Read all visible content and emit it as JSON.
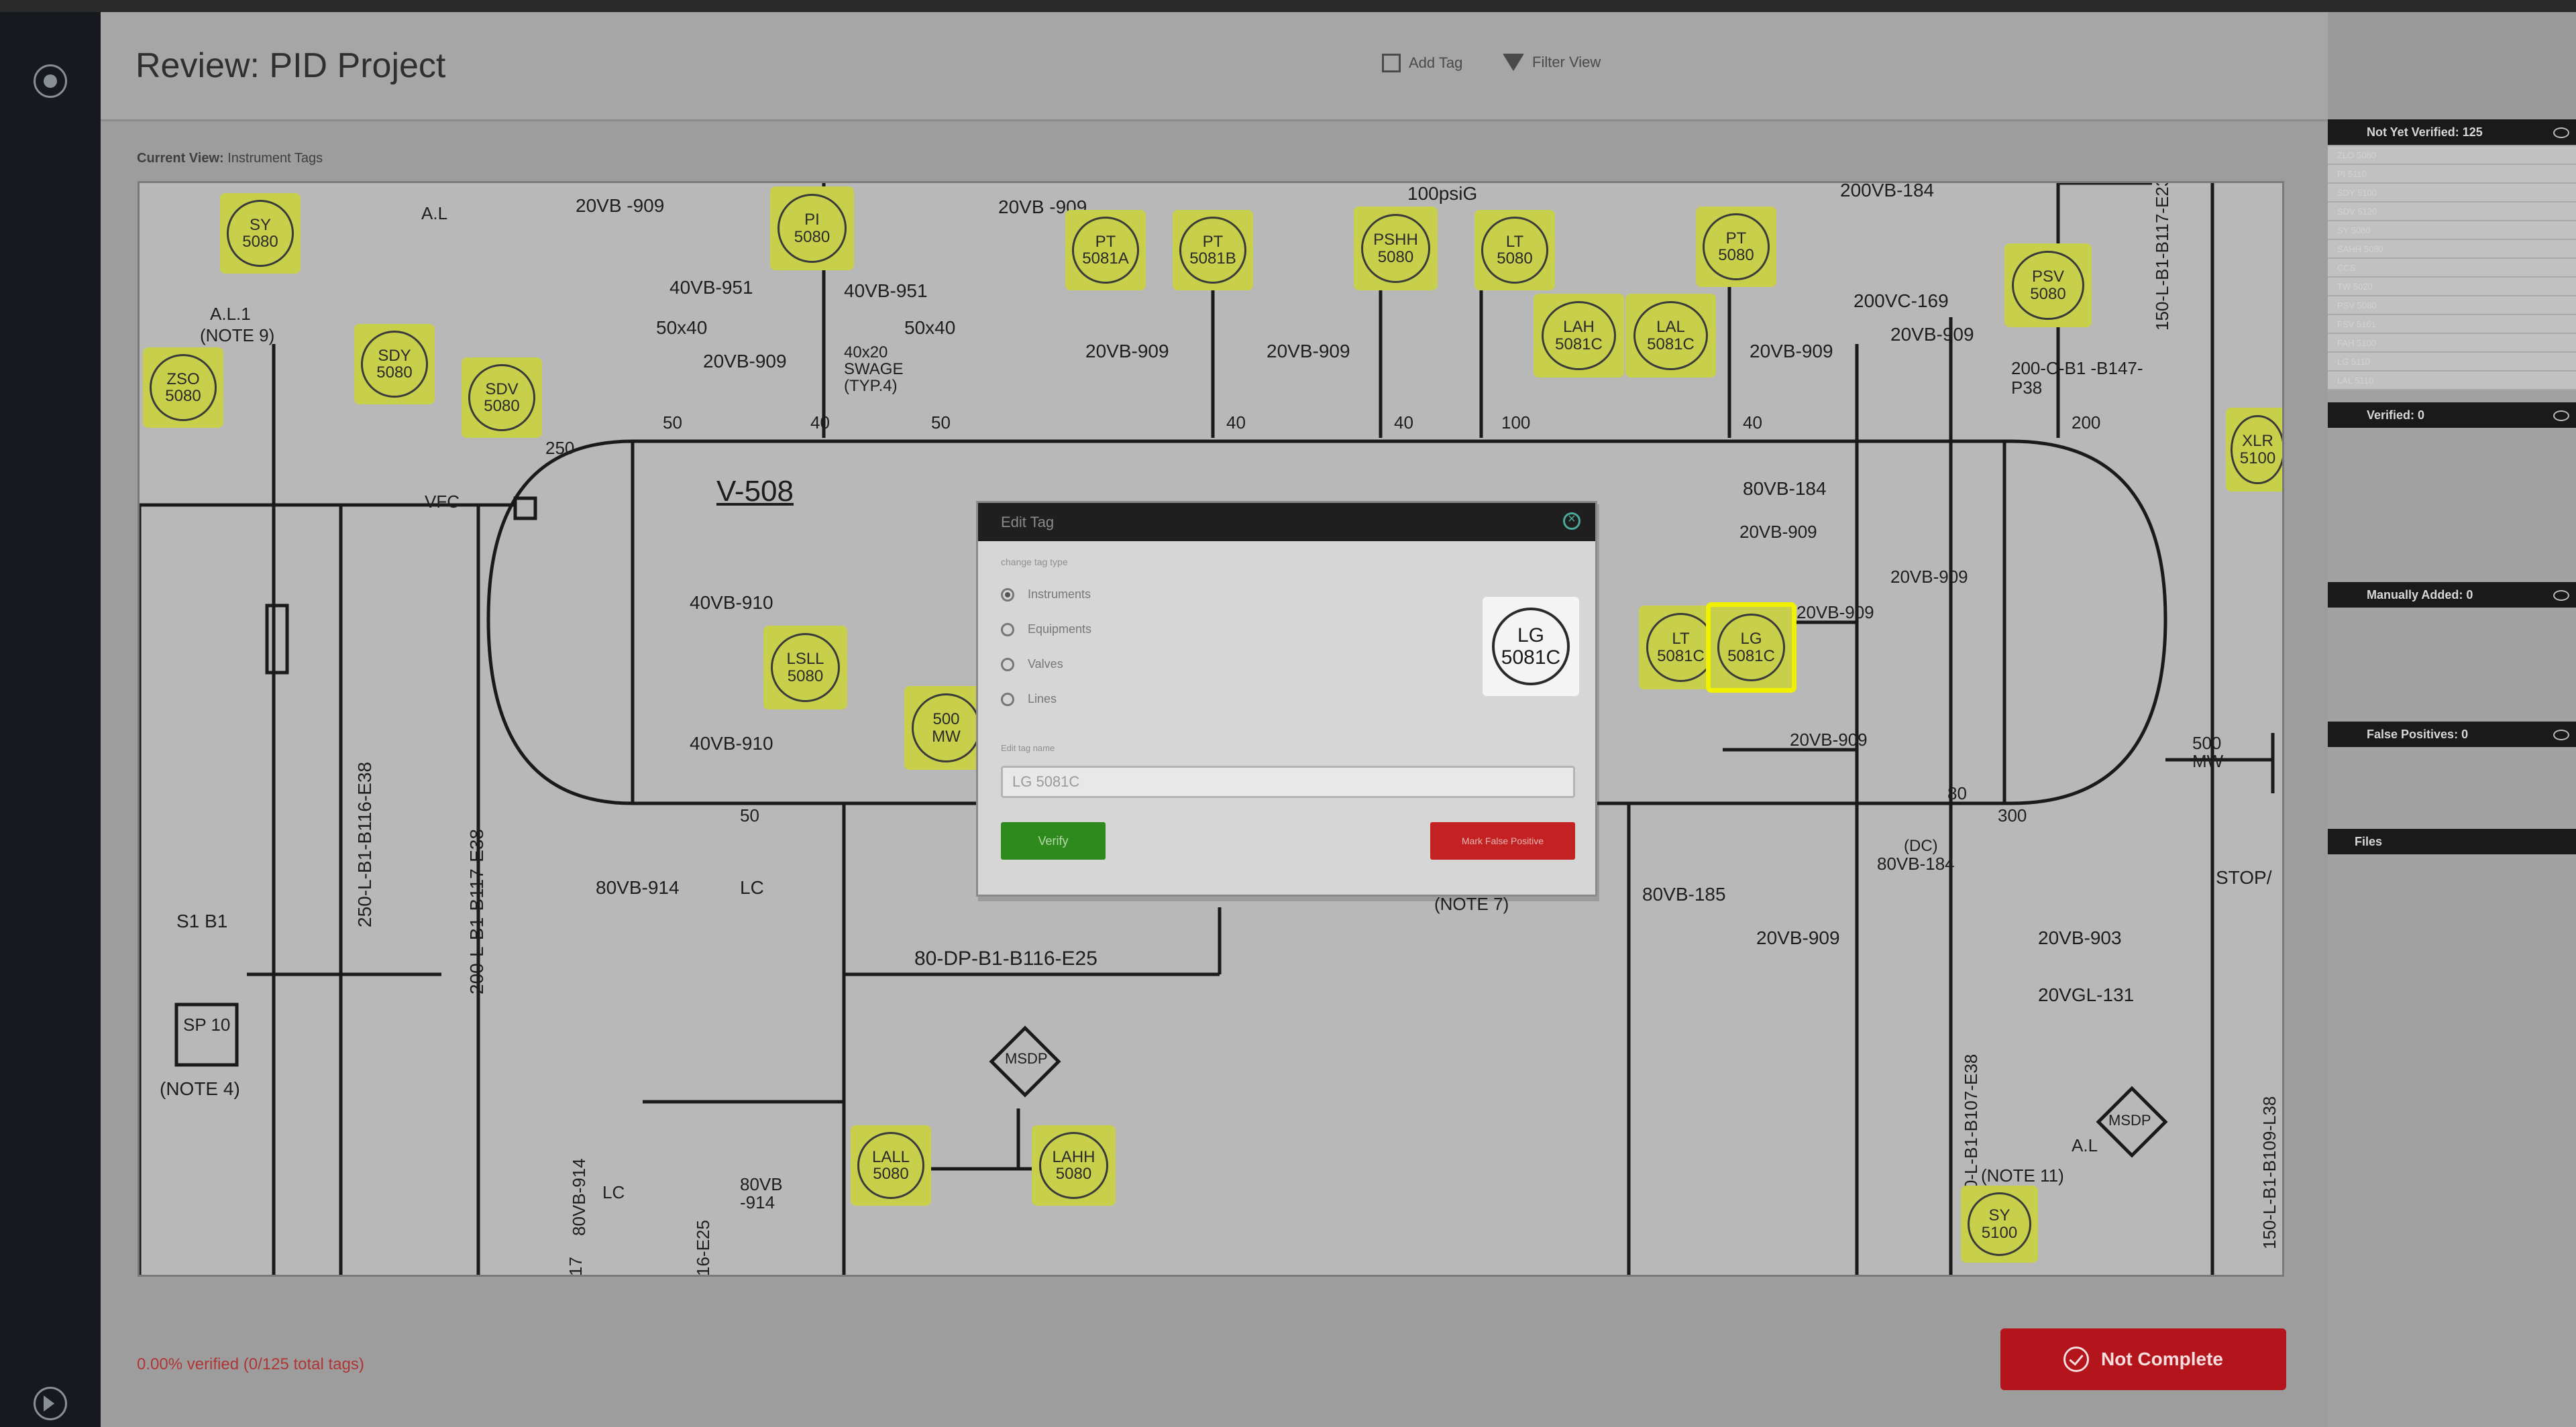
{
  "app": {
    "title": "Review: PID Project",
    "header_buttons": [
      {
        "label": "Add Tag",
        "icon": "add-tag-icon"
      },
      {
        "label": "Filter View",
        "icon": "filter-icon"
      }
    ]
  },
  "current_view": {
    "label": "Current View:",
    "value": "Instrument Tags"
  },
  "diagram": {
    "vessel_label": "V-508",
    "tags": [
      {
        "line1": "SY",
        "line2": "5080"
      },
      {
        "line1": "PI",
        "line2": "5080"
      },
      {
        "line1": "PT",
        "line2": "5081A"
      },
      {
        "line1": "PT",
        "line2": "5081B"
      },
      {
        "line1": "PSHH",
        "line2": "5080"
      },
      {
        "line1": "LT",
        "line2": "5080"
      },
      {
        "line1": "PT",
        "line2": "5080"
      },
      {
        "line1": "LAH",
        "line2": "5081C"
      },
      {
        "line1": "LAL",
        "line2": "5081C"
      },
      {
        "line1": "PSV",
        "line2": "5080"
      },
      {
        "line1": "ZSO",
        "line2": "5080"
      },
      {
        "line1": "SDY",
        "line2": "5080"
      },
      {
        "line1": "SDV",
        "line2": "5080"
      },
      {
        "line1": "LSLL",
        "line2": "5080"
      },
      {
        "line1": "500",
        "line2": "MW"
      },
      {
        "line1": "LT",
        "line2": "5081C"
      },
      {
        "line1": "LG",
        "line2": "5081C"
      },
      {
        "line1": "XLR",
        "line2": "5100"
      },
      {
        "line1": "LALL",
        "line2": "5080"
      },
      {
        "line1": "LAHH",
        "line2": "5080"
      },
      {
        "line1": "SY",
        "line2": "5100"
      }
    ],
    "labels": [
      "20VB -909",
      "20VB -909",
      "100psiG",
      "200VB-184",
      "A.L",
      "A.L.1",
      "(NOTE 9)",
      "40VB-951",
      "40VB-951",
      "50x40",
      "50x40",
      "20VB-909",
      "40x20 SWAGE (TYP.4)",
      "20VB-909",
      "20VB-909",
      "20VB-909",
      "200VC-169",
      "20VB-909",
      "200-C-B1 -B147-P38",
      "150-L-B1-B117-E23",
      "250",
      "VFC",
      "50",
      "40",
      "50",
      "40",
      "40",
      "100",
      "40",
      "200",
      "40VB-910",
      "40VB-910",
      "80VB-184",
      "20VB-909",
      "20VB-909",
      "20VB-909",
      "20VB-909",
      "500 MW",
      "250-L-B1-B116-E38",
      "200-L-B1-B117-E38",
      "S1 B1",
      "SP 10",
      "(NOTE 4)",
      "50",
      "80VB-914",
      "LC",
      "80-DP-B1-B116-E25",
      "MSDP",
      "80VB-914",
      "80VB -914",
      "LC",
      "80VB-185",
      "80VB-184",
      "20VB-909",
      "20VB-903",
      "20VGL-131",
      "MSDP",
      "A.L",
      "(NOTE 11)",
      "300-L-B1-B107-E38",
      "150-L-B1-B109-L38",
      "STOP/",
      "80",
      "300",
      "(NOTE 7)",
      "(DC)",
      "16-E25",
      "17"
    ]
  },
  "modal": {
    "title": "Edit Tag",
    "subtitle": "change tag type",
    "options": [
      {
        "label": "Instruments",
        "selected": true
      },
      {
        "label": "Equipments",
        "selected": false
      },
      {
        "label": "Valves",
        "selected": false
      },
      {
        "label": "Lines",
        "selected": false
      }
    ],
    "field_label": "Edit tag name",
    "field_value": "LG 5081C",
    "preview": {
      "line1": "LG",
      "line2": "5081C"
    },
    "verify_label": "Verify",
    "false_positive_label": "Mark False Positive"
  },
  "status": {
    "text": "0.00% verified (0/125 total tags)"
  },
  "not_complete_label": "Not Complete",
  "right_panel": {
    "sections": [
      {
        "title": "Not Yet Verified: 125",
        "icon": "eye-icon"
      },
      {
        "title": "Verified: 0",
        "icon": "eye-icon"
      },
      {
        "title": "Manually Added: 0",
        "icon": "eye-icon"
      },
      {
        "title": "False Positives: 0",
        "icon": "eye-icon"
      },
      {
        "title": "Files",
        "icon": "filter-icon"
      }
    ],
    "list": [
      "ZLO 5080",
      "PI 5110",
      "SDY 5100",
      "SDV 5120",
      "SY 5080",
      "SAHH 5080",
      "CCS",
      "TW 5020",
      "PSV 5080",
      "FSV 5161",
      "FAH 5100",
      "LG 5110",
      "LAL 5110"
    ]
  },
  "colors": {
    "tag_fill": "#c8cf4a",
    "selected_outline": "#f0f000",
    "not_complete": "#b4141b",
    "verify": "#2f8a1d",
    "false_positive": "#c42222"
  }
}
